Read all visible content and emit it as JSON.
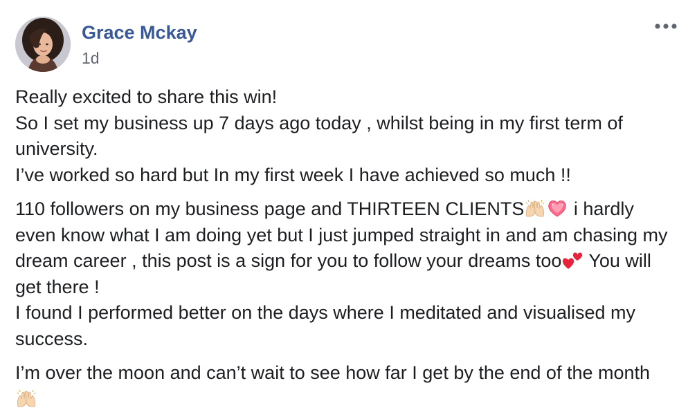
{
  "post": {
    "author": "Grace Mckay",
    "timestamp": "1d",
    "menu_icon": "more-horizontal-icon",
    "paragraphs": [
      {
        "lines": [
          "Really excited to share this win!",
          "So I set my business up 7 days ago today , whilst being in my first term of university.",
          "I’ve worked so hard but In my first week I have achieved so much !!"
        ]
      },
      {
        "segments": {
          "a": "110 followers on my business page and THIRTEEN CLIENTS",
          "b": " i hardly even know what I am doing yet but I just jumped straight in and am chasing my dream career , this post is a sign for you to follow your dreams too",
          "c": " You will get there !",
          "d": "I found I performed better on the days where I meditated and visualised my success."
        }
      },
      {
        "text": "I’m over the moon and can’t wait to see how far I get by the end of the month "
      }
    ],
    "emojis": {
      "raised_hands": "raising-hands-emoji",
      "heart": "sparkling-heart-emoji",
      "two_hearts": "heart-exclamation-emoji"
    }
  }
}
